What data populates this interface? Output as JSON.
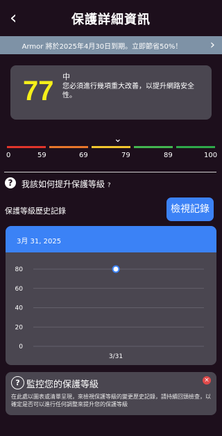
{
  "header": {
    "title": "保護詳細資訊",
    "back_icon": "chevron-left-icon"
  },
  "promo": {
    "text": "Armor 將於2025年4月30日到期。立即節省50%！",
    "icon": "chevron-right-icon"
  },
  "score": {
    "value": "77",
    "level": "中",
    "description": "您必須進行幾項重大改善，以提升網路安全性。"
  },
  "range": {
    "labels": [
      "0",
      "59",
      "69",
      "79",
      "89",
      "100"
    ],
    "colors": [
      "#e0352b",
      "#e7762b",
      "#f2c62e",
      "#43b550",
      "#2ea84a"
    ]
  },
  "improve": {
    "label": "我該如何提升保護等級",
    "suffix": "?"
  },
  "history": {
    "label": "保護等級歷史記錄",
    "button": "檢視記錄"
  },
  "chart_data": {
    "type": "line",
    "title": "3月 31, 2025",
    "x": [
      "3/31"
    ],
    "series": [
      {
        "values": [
          80
        ]
      }
    ],
    "yticks": [
      "80",
      "60",
      "40",
      "20",
      "0"
    ],
    "ylim": [
      0,
      80
    ],
    "grid": true
  },
  "monitor": {
    "title": "監控您的保護等級",
    "text": "在此處以圖表或清單呈現，來檢視保護等級的變更歷史記錄，請持續回頭檢查，以確定是否可以進行任何調整來提升您的保護等級"
  }
}
